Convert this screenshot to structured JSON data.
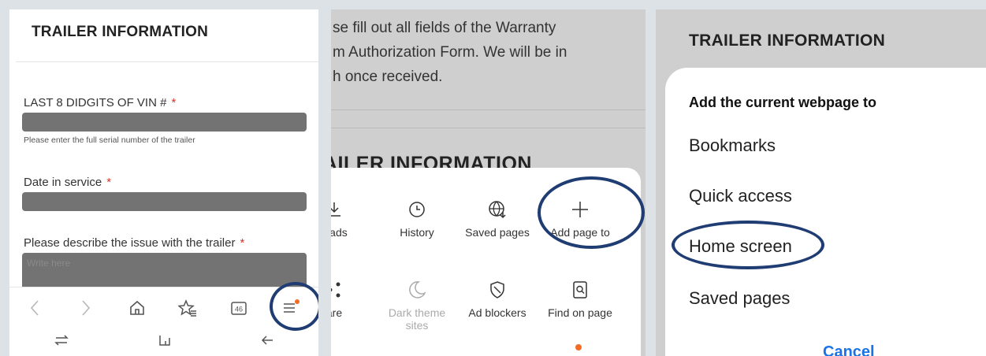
{
  "panel1": {
    "title": "TRAILER INFORMATION",
    "fields": [
      {
        "label": "LAST 8 DIDGITS OF VIN #",
        "required": "*",
        "help": "Please enter the full serial number of the trailer"
      },
      {
        "label": "Date in service",
        "required": "*"
      },
      {
        "label": "Please describe the issue with the trailer",
        "required": "*",
        "placeholder": "Write here"
      }
    ],
    "toolbar": {
      "tab_count": "46"
    },
    "icons": [
      "back-icon",
      "forward-icon",
      "home-icon",
      "bookmarks-icon",
      "tabs-icon",
      "menu-icon"
    ]
  },
  "panel2": {
    "paragraph_lines": [
      "se fill out all fields of the Warranty",
      "m Authorization Form. We will be in",
      "h once received."
    ],
    "subtitle": "AILER INFORMATION",
    "menu": [
      {
        "label": "loads",
        "icon": "download-icon"
      },
      {
        "label": "History",
        "icon": "history-icon"
      },
      {
        "label": "Saved pages",
        "icon": "saved-pages-icon"
      },
      {
        "label": "Add page to",
        "icon": "plus-icon"
      },
      {
        "label": "are",
        "icon": "share-icon"
      },
      {
        "label": "Dark theme sites",
        "icon": "moon-icon",
        "disabled": true
      },
      {
        "label": "Ad blockers",
        "icon": "shield-icon"
      },
      {
        "label": "Find on page",
        "icon": "find-icon"
      }
    ]
  },
  "panel3": {
    "title": "TRAILER INFORMATION",
    "sheet_heading": "Add the current webpage to",
    "options": [
      "Bookmarks",
      "Quick access",
      "Home screen",
      "Saved pages"
    ],
    "cancel": "Cancel"
  },
  "colors": {
    "highlight_circle": "#1f3c73",
    "notification_dot": "#f26c24",
    "cancel_blue": "#1a73e8"
  }
}
